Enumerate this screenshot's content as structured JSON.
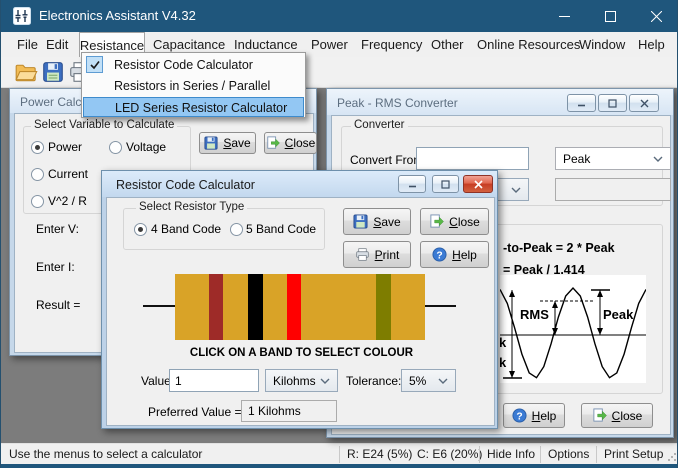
{
  "app": {
    "title": "Electronics Assistant V4.32"
  },
  "menu_bar": {
    "items": [
      "File",
      "Edit",
      "Resistance",
      "Capacitance",
      "Inductance",
      "Power",
      "Frequency",
      "Other",
      "Online Resources",
      "Window",
      "Help"
    ],
    "open_item": "Resistance"
  },
  "toolbar": {
    "icons": [
      "open-file",
      "save",
      "print"
    ]
  },
  "resistance_menu": {
    "items": [
      {
        "label": "Resistor Code Calculator",
        "checked": true,
        "highlighted": false
      },
      {
        "label": "Resistors in Series / Parallel",
        "checked": false,
        "highlighted": false
      },
      {
        "label": "LED Series Resistor Calculator",
        "checked": false,
        "highlighted": true
      }
    ]
  },
  "power_calc_window": {
    "title": "Power Calc",
    "group_label": "Select Variable to Calculate",
    "radios": [
      "Power",
      "Voltage",
      "Current",
      "V^2 / R"
    ],
    "selected_radio": "Power",
    "save_button": "Save",
    "close_button": "Close",
    "enter_v_label": "Enter V:",
    "enter_i_label": "Enter I:",
    "result_label": "Result ="
  },
  "peak_rms_window": {
    "title": "Peak - RMS Converter",
    "group_label": "Converter",
    "convert_from_label": "Convert From:",
    "convert_from_value": "",
    "unit_selected": "Peak",
    "result_value": "",
    "formula_fragment_1": "-to-Peak = 2 * Peak",
    "formula_fragment_2": "= Peak / 1.414",
    "diagram": {
      "rms_label": "RMS",
      "peak_label": "Peak",
      "left_fragment_1": "k",
      "left_fragment_2": "k"
    },
    "help_button": "Help",
    "close_button": "Close"
  },
  "resistor_dialog": {
    "title": "Resistor Code Calculator",
    "group_label": "Select Resistor Type",
    "radio_options": [
      "4 Band Code",
      "5 Band Code"
    ],
    "selected_radio": "4 Band Code",
    "save_button": "Save",
    "close_button": "Close",
    "print_button": "Print",
    "help_button": "Help",
    "instruction": "CLICK ON A BAND TO SELECT COLOUR",
    "value_label": "Value:",
    "value": "1",
    "unit_selected": "Kilohms",
    "tolerance_label": "Tolerance:",
    "tolerance_selected": "5%",
    "preferred_label": "Preferred Value =",
    "preferred_value": "1 Kilohms",
    "resistor_colors": {
      "body": "#D9A327",
      "band_1": "#9E2B28",
      "band_2": "#000000",
      "band_3": "#FF0000",
      "band_4": "#7E7D00"
    }
  },
  "status_bar": {
    "message": "Use the menus to select a calculator",
    "r_series": "R: E24 (5%)",
    "c_series": "C: E6 (20%)",
    "hide_info": "Hide Info",
    "options": "Options",
    "print_setup": "Print Setup"
  },
  "icons": {
    "help_glyph": "?"
  }
}
